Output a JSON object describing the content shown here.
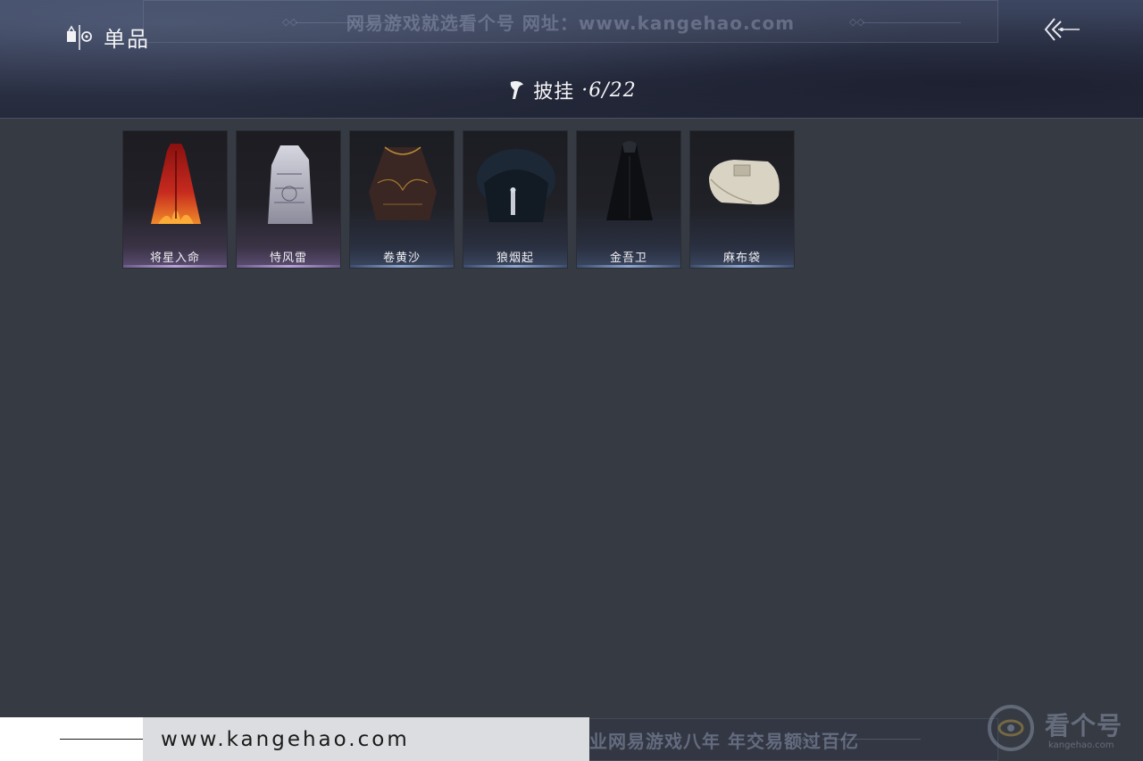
{
  "header": {
    "title": "单品",
    "title_icon": "items-icon",
    "back_icon": "back-arrow-icon",
    "watermark": "网易游戏就选看个号  网址：www.kangehao.com"
  },
  "category": {
    "icon": "cloak-icon",
    "label": "披挂",
    "count": "·6/22"
  },
  "items": [
    {
      "name": "将星入命",
      "tier": "purple",
      "art": "red-flame-cape"
    },
    {
      "name": "恃风雷",
      "tier": "purple",
      "art": "white-embroidered-cape"
    },
    {
      "name": "卷黄沙",
      "tier": "blue",
      "art": "dark-gold-embroidered-coat"
    },
    {
      "name": "狼烟起",
      "tier": "blue",
      "art": "black-fur-cloak"
    },
    {
      "name": "金吾卫",
      "tier": "blue",
      "art": "black-hooded-cloak"
    },
    {
      "name": "麻布袋",
      "tier": "blue",
      "art": "burlap-sack"
    }
  ],
  "footer": {
    "site_url": "www.kangehao.com",
    "slogan": "看个号专业网易游戏八年  年交易额过百亿",
    "brand_name": "看个号",
    "brand_domain": "kangehao.com"
  },
  "colors": {
    "background": "#363a43",
    "tier_purple": "#b6a4d6",
    "tier_blue": "#8ea6cf"
  }
}
